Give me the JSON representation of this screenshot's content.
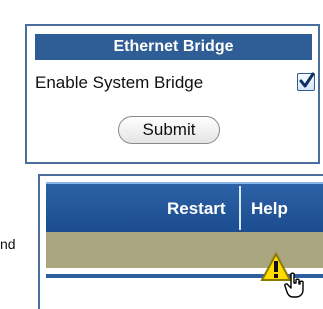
{
  "bridge_panel": {
    "title": "Ethernet Bridge",
    "enable_label": "Enable System Bridge",
    "enable_checked": true,
    "submit_label": "Submit"
  },
  "partial_text": "nd",
  "nav": {
    "links": [
      "Restart",
      "Help"
    ]
  },
  "colors": {
    "panel_border": "#4a6f9a",
    "header_bg": "#2f5d95",
    "navbar_bg": "#1c4c8f",
    "status_strip_bg": "#a8a57f",
    "warning_yellow": "#ffdd00"
  },
  "icons": {
    "checkbox": "checkmark-icon",
    "warning": "warning-icon",
    "pointer": "hand-cursor-icon"
  }
}
